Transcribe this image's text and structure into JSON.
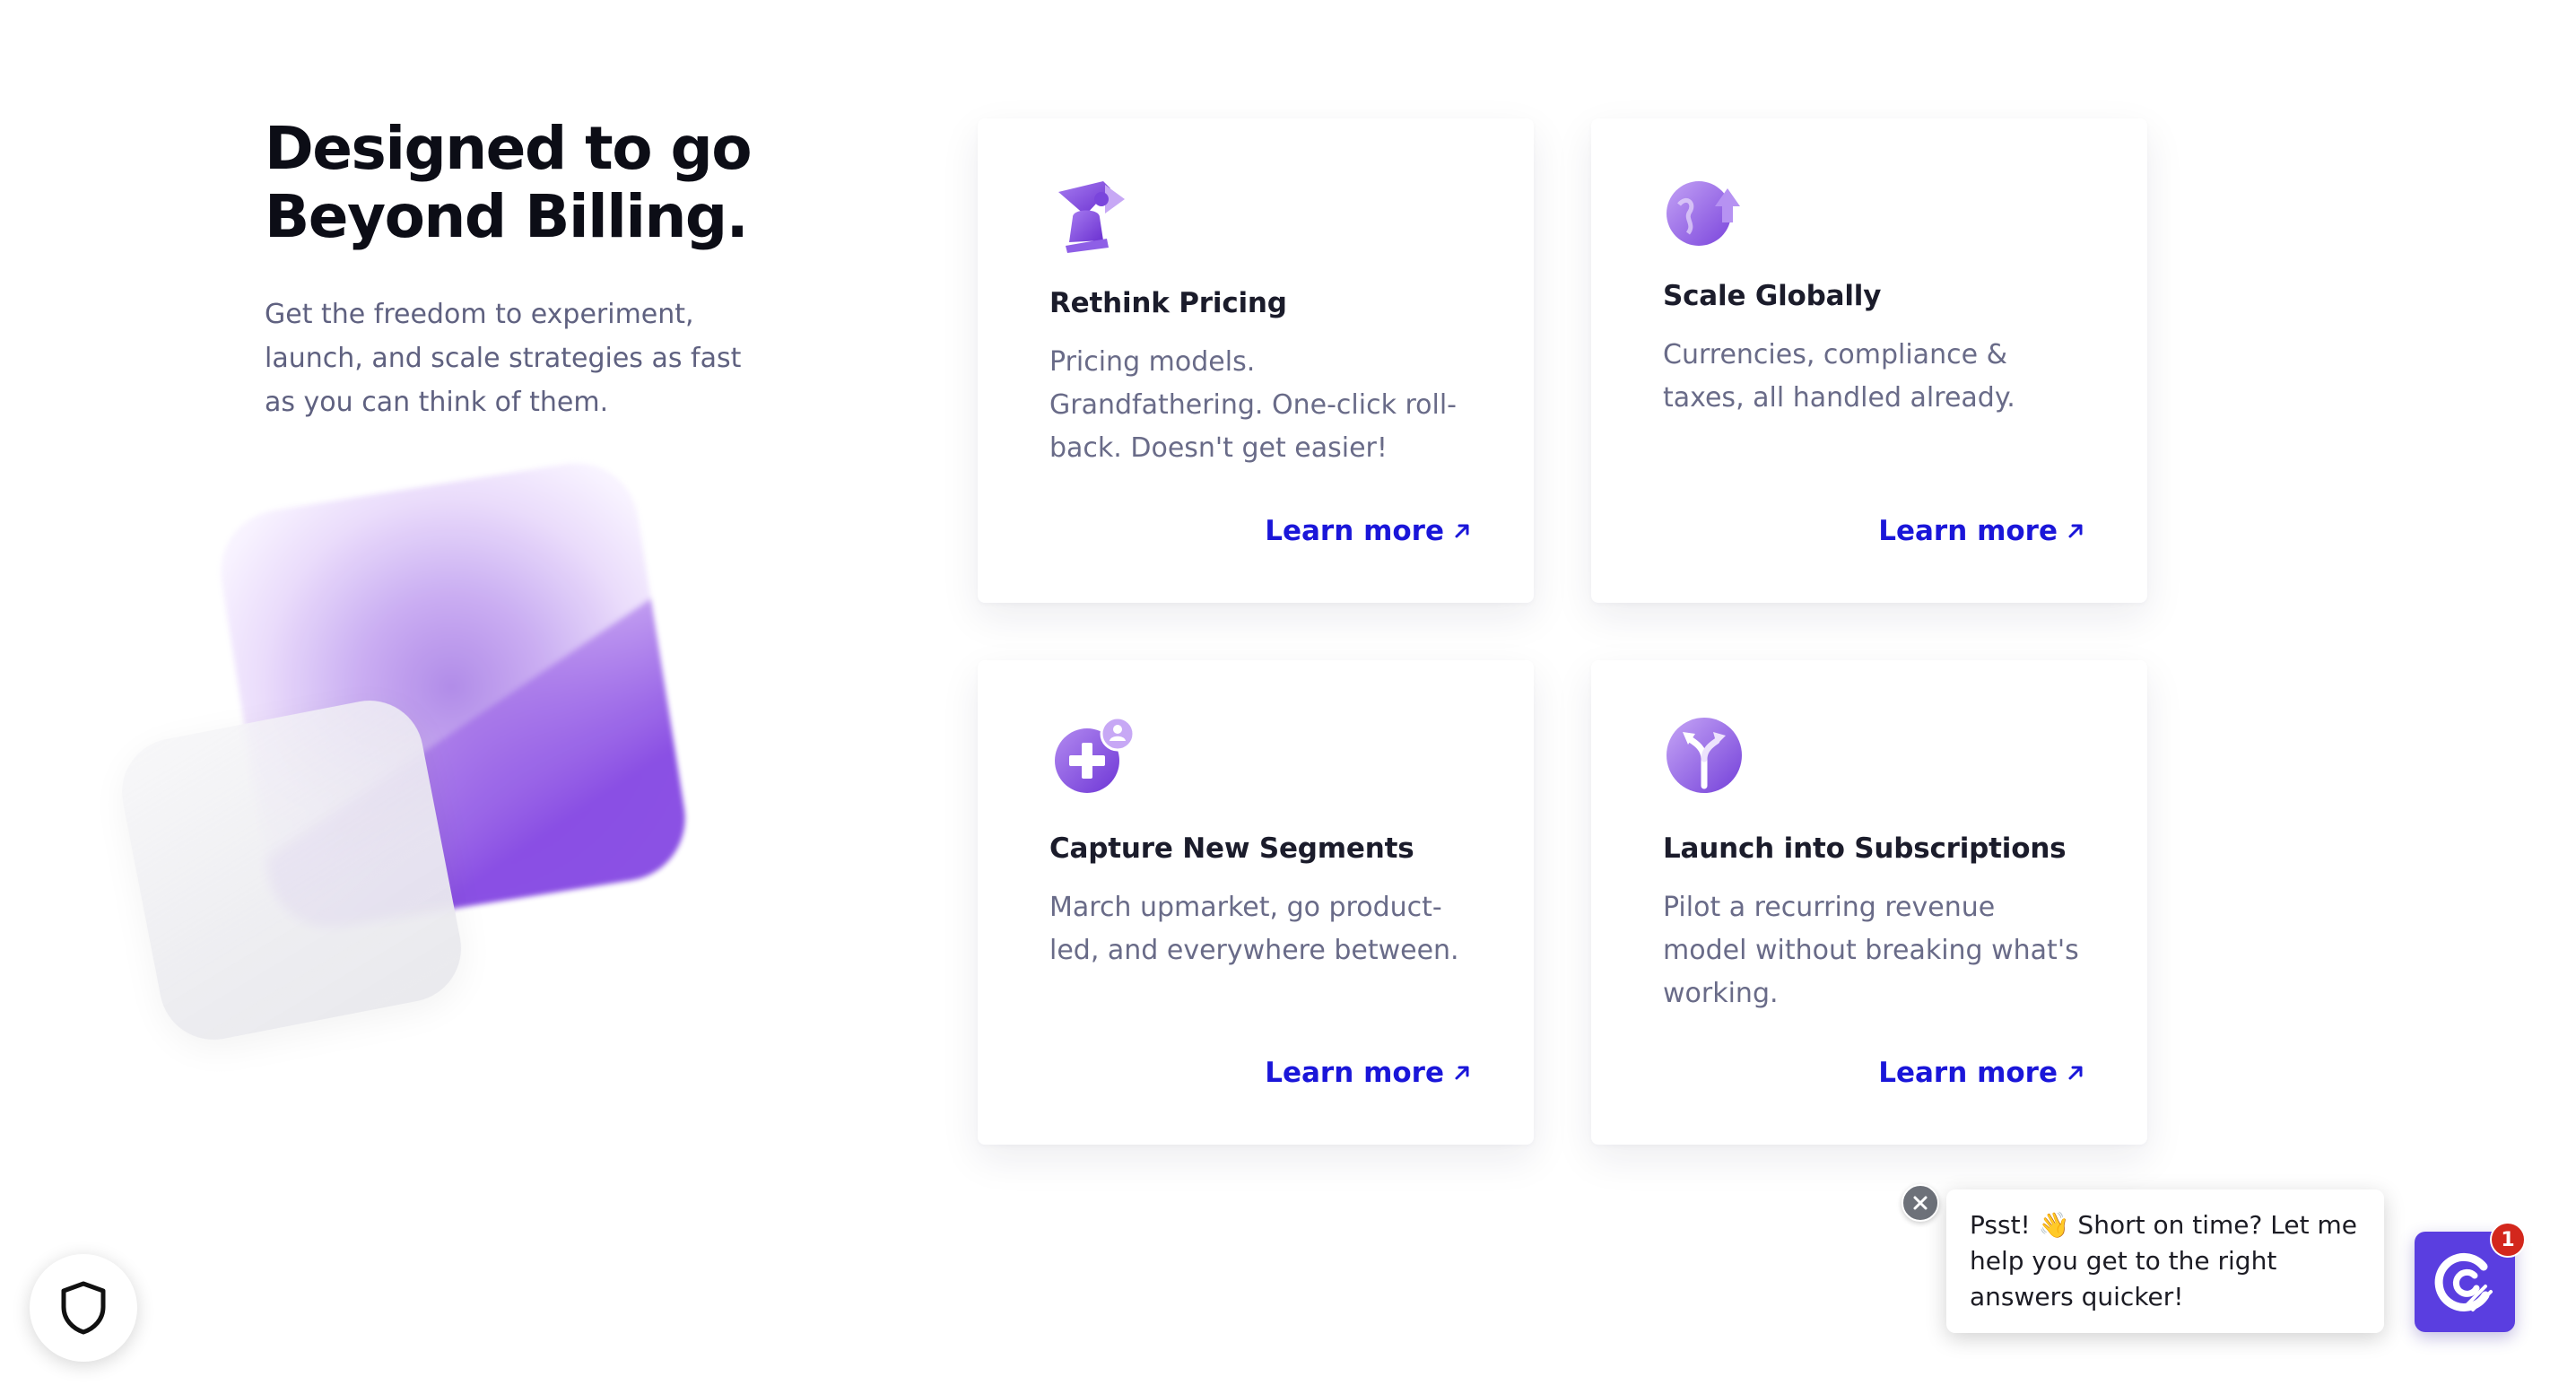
{
  "intro": {
    "heading": "Designed to go\nBeyond Billing.",
    "subtext": "Get the freedom to experiment, launch, and scale strategies as fast as you can think of them."
  },
  "features": [
    {
      "icon": "pricing-hourglass-icon",
      "title": "Rethink Pricing",
      "description": "Pricing models. Grandfathering. One-click roll-back. Doesn't get easier!",
      "link_label": "Learn more"
    },
    {
      "icon": "globe-upload-icon",
      "title": "Scale Globally",
      "description": "Currencies, compliance & taxes, all handled already.",
      "link_label": "Learn more"
    },
    {
      "icon": "add-user-segment-icon",
      "title": "Capture New Segments",
      "description": "March upmarket, go product-led, and everywhere between.",
      "link_label": "Learn more"
    },
    {
      "icon": "subscription-arrows-icon",
      "title": "Launch into Subscriptions",
      "description": "Pilot a recurring revenue model without breaking what's working.",
      "link_label": "Learn more"
    }
  ],
  "chat": {
    "message": "Psst! 👋 Short on time? Let me help you get to the right answers quicker!",
    "unread_count": "1"
  },
  "colors": {
    "accent_link": "#1a16d9",
    "icon_purple": "#8b5cf6",
    "chat_launcher": "#5a3ee0",
    "badge_red": "#d3271c"
  }
}
